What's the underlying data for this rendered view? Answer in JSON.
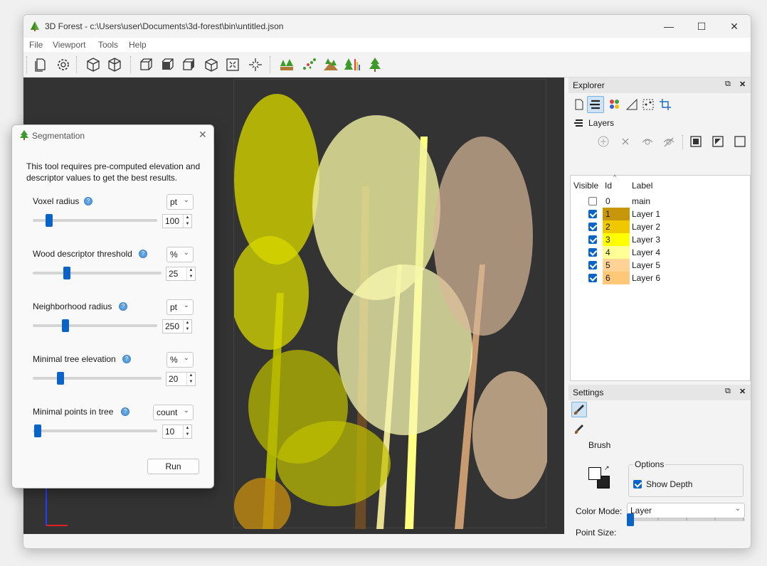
{
  "window": {
    "title": "3D Forest - c:\\Users\\user\\Documents\\3d-forest\\bin\\untitled.json",
    "controls": {
      "minimize": "—",
      "maximize": "☐",
      "close": "✕"
    }
  },
  "menu": [
    "File",
    "Viewport",
    "Tools",
    "Help"
  ],
  "toolbar_icons": [
    "new-file-icon",
    "settings-gear-icon",
    "cube-perspective-icon",
    "cube-ortho-icon",
    "view-front-icon",
    "view-side-icon",
    "view-top-icon",
    "view-iso-icon",
    "zoom-fit-icon",
    "zoom-center-icon",
    "ground-tool-icon",
    "descriptor-tool-icon",
    "elevation-tool-icon",
    "height-color-tool-icon",
    "segmentation-tool-icon"
  ],
  "segmentation": {
    "title": "Segmentation",
    "description": "This tool requires pre-computed elevation and descriptor values to get the best results.",
    "params": [
      {
        "label": "Voxel radius",
        "unit": "pt",
        "value": "100",
        "level": 0.11
      },
      {
        "label": "Wood descriptor threshold",
        "unit": "%",
        "value": "25",
        "level": 0.25
      },
      {
        "label": "Neighborhood radius",
        "unit": "pt",
        "value": "250",
        "level": 0.25
      },
      {
        "label": "Minimal tree elevation",
        "unit": "%",
        "value": "20",
        "level": 0.2
      },
      {
        "label": "Minimal points in tree",
        "unit": "count",
        "value": "10",
        "level": 0.01
      }
    ],
    "run_label": "Run",
    "close_icon": "close-icon"
  },
  "explorer": {
    "title": "Explorer",
    "section_label": "Layers",
    "columns": {
      "visible": "Visible",
      "id": "Id",
      "label": "Label"
    },
    "layers": [
      {
        "id": "0",
        "label": "main",
        "visible": false,
        "color": ""
      },
      {
        "id": "1",
        "label": "Layer 1",
        "visible": true,
        "color": "#c8960a"
      },
      {
        "id": "2",
        "label": "Layer 2",
        "visible": true,
        "color": "#f0c800"
      },
      {
        "id": "3",
        "label": "Layer 3",
        "visible": true,
        "color": "#ffff00"
      },
      {
        "id": "4",
        "label": "Layer 4",
        "visible": true,
        "color": "#ffff96"
      },
      {
        "id": "5",
        "label": "Layer 5",
        "visible": true,
        "color": "#ffd296"
      },
      {
        "id": "6",
        "label": "Layer 6",
        "visible": true,
        "color": "#ffc878"
      }
    ]
  },
  "settings": {
    "title": "Settings",
    "section_label": "Brush",
    "options_label": "Options",
    "show_depth_label": "Show Depth",
    "show_depth": true,
    "color_mode_label": "Color Mode:",
    "color_mode_value": "Layer",
    "point_size_label": "Point Size:",
    "point_size_level": 0.0
  },
  "colors": {
    "accent": "#0a64c8",
    "viewport_bg": "#333333"
  }
}
